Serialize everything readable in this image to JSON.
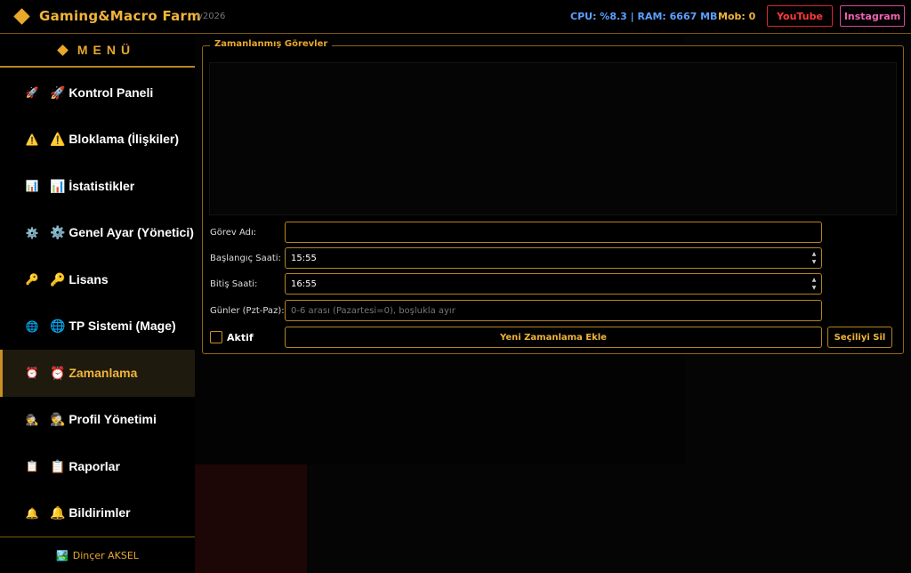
{
  "header": {
    "title": "Gaming&Macro Farm",
    "version": "v2026",
    "sysinfo": "CPU: %8.3 | RAM: 6667 MB",
    "mob": "Mob: 0",
    "youtube_label": "YouTube",
    "instagram_label": "Instagram"
  },
  "sidebar": {
    "menu_title": "MENÜ",
    "items": [
      {
        "icon": "🚀",
        "label": "🚀 Kontrol Paneli"
      },
      {
        "icon": "⚠️",
        "label": "⚠️ Bloklama (İlişkiler)"
      },
      {
        "icon": "📊",
        "label": "📊 İstatistikler"
      },
      {
        "icon": "⚙️",
        "label": "⚙️ Genel Ayar (Yönetici)"
      },
      {
        "icon": "🔑",
        "label": "🔑 Lisans"
      },
      {
        "icon": "🌐",
        "label": "🌐 TP Sistemi (Mage)"
      },
      {
        "icon": "⏰",
        "label": "⏰ Zamanlama"
      },
      {
        "icon": "🕵️",
        "label": "🕵️ Profil Yönetimi"
      },
      {
        "icon": "📋",
        "label": "📋 Raporlar"
      },
      {
        "icon": "🔔",
        "label": "🔔 Bildirimler"
      }
    ],
    "active_index": 6,
    "footer_icon": "🏞️",
    "footer_user": "Dinçer AKSEL"
  },
  "scheduler": {
    "legend": "Zamanlanmış Görevler",
    "task_name_label": "Görev Adı:",
    "task_name_value": "",
    "start_label": "Başlangıç Saati:",
    "start_value": "15:55",
    "end_label": "Bitiş Saati:",
    "end_value": "16:55",
    "days_label": "Günler (Pzt-Paz):",
    "days_placeholder": "0-6 arası (Pazartesi=0), boşlukla ayır",
    "active_label": "Aktif",
    "active_checked": false,
    "add_button": "Yeni Zamanlama Ekle",
    "delete_button": "Seçiliyi Sil"
  },
  "colors": {
    "accent": "#e8a82a",
    "cpu_text": "#5aa0ff",
    "youtube": "#d4262d",
    "instagram": "#d64a9a"
  }
}
